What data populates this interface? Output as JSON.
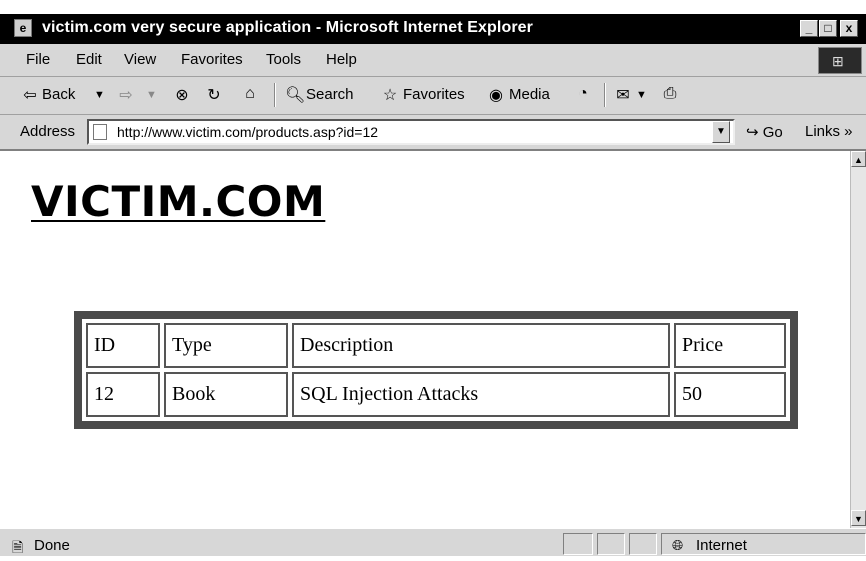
{
  "window": {
    "title": "victim.com very secure application - Microsoft Internet Explorer",
    "minimize": "_",
    "maximize": "□",
    "close": "x"
  },
  "menu": {
    "items": [
      "File",
      "Edit",
      "View",
      "Favorites",
      "Tools",
      "Help"
    ]
  },
  "toolbar": {
    "back_label": "Back",
    "search_label": "Search",
    "favorites_label": "Favorites",
    "media_label": "Media"
  },
  "address": {
    "label": "Address",
    "url": "http://www.victim.com/products.asp?id=12",
    "go_label": "Go",
    "links_label": "Links »"
  },
  "page": {
    "heading": "VICTIM.COM",
    "table": {
      "headers": [
        "ID",
        "Type",
        "Description",
        "Price"
      ],
      "rows": [
        [
          "12",
          "Book",
          "SQL Injection Attacks",
          "50"
        ]
      ]
    }
  },
  "status": {
    "text": "Done",
    "zone": "Internet"
  },
  "colors": {
    "titlebar": "#000000",
    "chrome": "#d7d7d7",
    "table_frame": "#4a4a4a"
  }
}
